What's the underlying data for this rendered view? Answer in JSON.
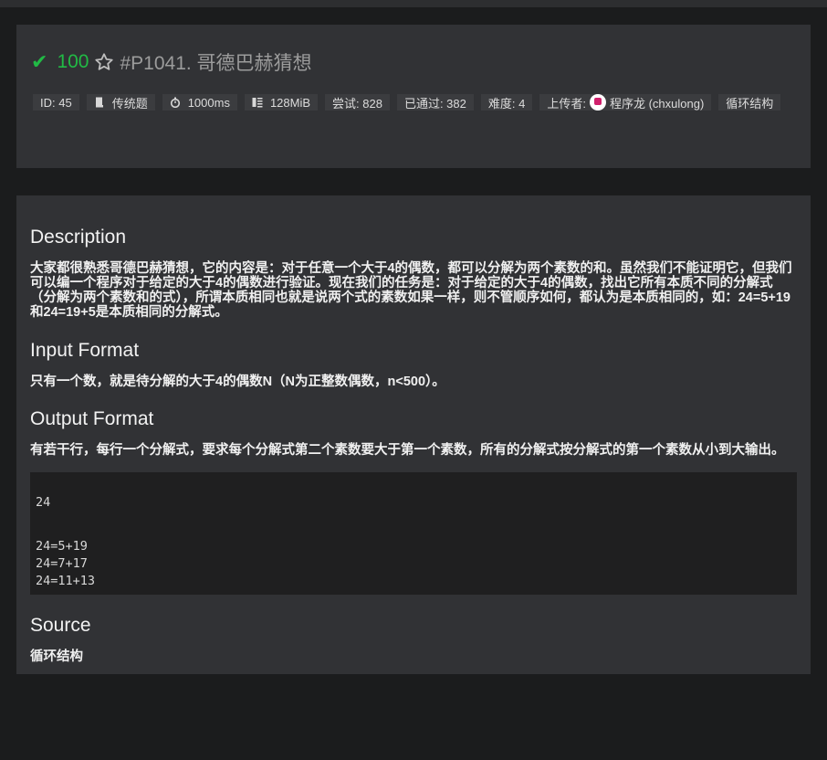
{
  "problem": {
    "score": "100",
    "title": "#P1041. 哥德巴赫猜想",
    "meta": {
      "id": "ID: 45",
      "type": "传统题",
      "time_limit": "1000ms",
      "memory_limit": "128MiB",
      "attempts": "尝试: 828",
      "accepted": "已通过: 382",
      "difficulty": "难度: 4",
      "uploader_label": "上传者:",
      "uploader": "程序龙 (chxulong)",
      "tag": "循环结构"
    }
  },
  "content": {
    "description_heading": "Description",
    "description_text": "大家都很熟悉哥德巴赫猜想，它的内容是：对于任意一个大于4的偶数，都可以分解为两个素数的和。虽然我们不能证明它，但我们可以编一个程序对于给定的大于4的偶数进行验证。现在我们的任务是：对于给定的大于4的偶数，找出它所有本质不同的分解式（分解为两个素数和的式），所谓本质相同也就是说两个式的素数如果一样，则不管顺序如何，都认为是本质相同的，如：24=5+19和24=19+5是本质相同的分解式。",
    "input_heading": "Input Format",
    "input_text": "只有一个数，就是待分解的大于4的偶数N（N为正整数偶数，n<500）。",
    "output_heading": "Output Format",
    "output_text": "有若干行，每行一个分解式，要求每个分解式第二个素数要大于第一个素数，所有的分解式按分解式的第一个素数从小到大输出。",
    "sample_input": "24",
    "sample_output_lines": [
      "24=5+19",
      "24=7+17",
      "24=11+13"
    ],
    "source_heading": "Source",
    "source_text": "循环结构"
  },
  "colors": {
    "accepted_green": "#21ba45",
    "page_bg": "#1b1c1d",
    "panel_bg": "#313235",
    "code_bg": "#1f1f20"
  },
  "icons": [
    "check-icon",
    "star-icon",
    "book-icon",
    "stopwatch-icon",
    "memory-icon",
    "avatar"
  ]
}
